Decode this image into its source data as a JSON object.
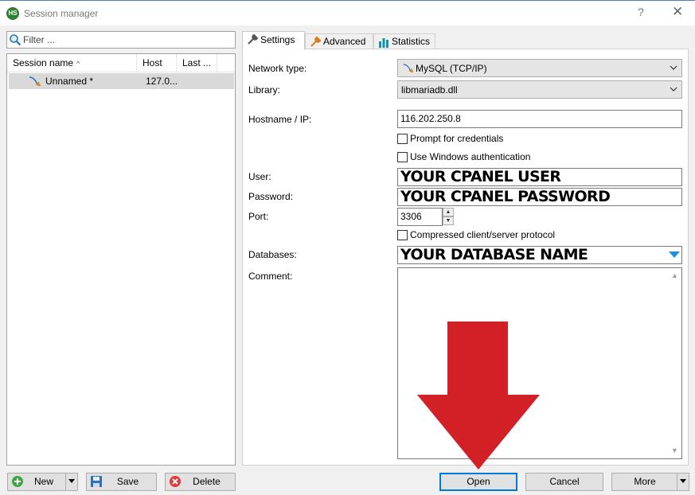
{
  "window": {
    "title": "Session manager",
    "icon_text": "HS",
    "help_glyph": "?",
    "close_glyph": "✕"
  },
  "filter": {
    "placeholder": "Filter ..."
  },
  "session_list": {
    "columns": [
      "Session name",
      "Host",
      "Last ..."
    ],
    "rows": [
      {
        "name": "Unnamed *",
        "host": "127.0...",
        "last": ""
      }
    ]
  },
  "tabs": [
    {
      "label": "Settings",
      "icon": "wrench-icon",
      "active": true
    },
    {
      "label": "Advanced",
      "icon": "wrench-orange-icon",
      "active": false
    },
    {
      "label": "Statistics",
      "icon": "bar-chart-icon",
      "active": false
    }
  ],
  "settings": {
    "network_type": {
      "label": "Network type:",
      "value": "MySQL (TCP/IP)"
    },
    "library": {
      "label": "Library:",
      "value": "libmariadb.dll"
    },
    "hostname": {
      "label": "Hostname / IP:",
      "value": "116.202.250.8"
    },
    "prompt_credentials": {
      "label": "Prompt for credentials",
      "checked": false
    },
    "windows_auth": {
      "label": "Use Windows authentication",
      "checked": false
    },
    "user": {
      "label": "User:",
      "value": "YOUR CPANEL USER"
    },
    "password": {
      "label": "Password:",
      "value": "YOUR CPANEL PASSWORD"
    },
    "port": {
      "label": "Port:",
      "value": "3306"
    },
    "compressed": {
      "label": "Compressed client/server protocol",
      "checked": false
    },
    "databases": {
      "label": "Databases:",
      "value": "YOUR DATABASE NAME"
    },
    "comment": {
      "label": "Comment:",
      "value": ""
    }
  },
  "buttons": {
    "new": "New",
    "save": "Save",
    "delete": "Delete",
    "open": "Open",
    "cancel": "Cancel",
    "more": "More"
  },
  "colors": {
    "accent": "#0078d7",
    "annotation_arrow": "#d32027",
    "dropdown_arrow_blue": "#1e8fe0"
  }
}
